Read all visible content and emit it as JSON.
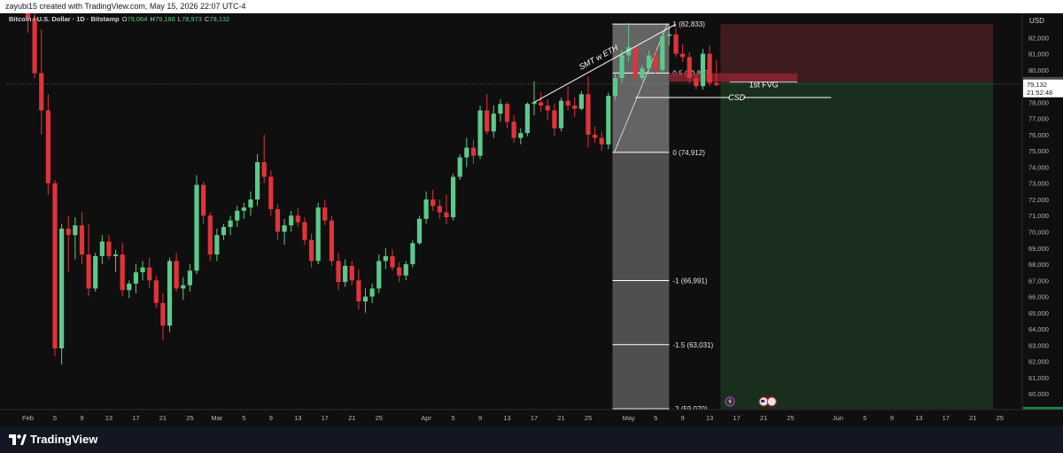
{
  "header": {
    "credit": "zayubi15 created with TradingView.com, May 15, 2026 22:07 UTC-4"
  },
  "legend": {
    "symbol": "Bitcoin / U.S. Dollar · 1D · Bitstamp",
    "o_label": "O",
    "o_value": "79,064",
    "h_label": "H",
    "h_value": "79,186",
    "l_label": "L",
    "l_value": "78,973",
    "c_label": "C",
    "c_value": "79,132"
  },
  "price_scale": {
    "currency": "USD",
    "last_price": "79,132",
    "countdown": "21:52:48",
    "ref_price": "79,264",
    "bottom_price": "59,020"
  },
  "annotations": {
    "smt": "SMT w ETH",
    "fvg": "1st FVG",
    "csd": "CSD",
    "fib_levels": [
      {
        "ratio": 1,
        "label": "1 (82,833)",
        "price": 82833
      },
      {
        "ratio": 0.5,
        "label": "0.5 (79,807)",
        "price": 79807
      },
      {
        "ratio": 0,
        "label": "0 (74,912)",
        "price": 74912
      },
      {
        "ratio": -1,
        "label": "-1 (66,991)",
        "price": 66991
      },
      {
        "ratio": -1.5,
        "label": "-1.5 (63,031)",
        "price": 63031
      },
      {
        "ratio": -2,
        "label": "-2 (59,070)",
        "price": 59070
      }
    ]
  },
  "colors": {
    "up": "#5cc98a",
    "down": "#e0333a",
    "background": "#0f0f0f",
    "fib_fill": "#5a5a5a",
    "stop_zone": "#3d1b1f",
    "target_zone": "#1a2e1d",
    "fvg_box": "#8a2430",
    "last_price_tag": "#ffffff",
    "bottom_tag": "#1f8a4c"
  },
  "footer": {
    "brand": "TradingView"
  },
  "chart_data": {
    "type": "candlestick",
    "interval": "1D",
    "symbol": "BTCUSD",
    "ylim": [
      59020,
      83500
    ],
    "y_ticks": [
      60000,
      61000,
      62000,
      63000,
      64000,
      65000,
      66000,
      67000,
      68000,
      69000,
      70000,
      71000,
      72000,
      73000,
      74000,
      75000,
      76000,
      77000,
      78000,
      79000,
      80000,
      81000,
      82000
    ],
    "x_ticks": [
      {
        "label": "Feb",
        "i": 0
      },
      {
        "label": "5",
        "i": 4
      },
      {
        "label": "9",
        "i": 8
      },
      {
        "label": "13",
        "i": 12
      },
      {
        "label": "17",
        "i": 16
      },
      {
        "label": "21",
        "i": 20
      },
      {
        "label": "25",
        "i": 24
      },
      {
        "label": "Mar",
        "i": 28
      },
      {
        "label": "5",
        "i": 32
      },
      {
        "label": "9",
        "i": 36
      },
      {
        "label": "13",
        "i": 40
      },
      {
        "label": "17",
        "i": 44
      },
      {
        "label": "21",
        "i": 48
      },
      {
        "label": "25",
        "i": 52
      },
      {
        "label": "Apr",
        "i": 59
      },
      {
        "label": "5",
        "i": 63
      },
      {
        "label": "9",
        "i": 67
      },
      {
        "label": "13",
        "i": 71
      },
      {
        "label": "17",
        "i": 75
      },
      {
        "label": "21",
        "i": 79
      },
      {
        "label": "25",
        "i": 83
      },
      {
        "label": "May",
        "i": 89
      },
      {
        "label": "5",
        "i": 93
      },
      {
        "label": "9",
        "i": 97
      },
      {
        "label": "13",
        "i": 101
      },
      {
        "label": "17",
        "i": 105
      },
      {
        "label": "21",
        "i": 109
      },
      {
        "label": "25",
        "i": 113
      },
      {
        "label": "Jun",
        "i": 120
      },
      {
        "label": "5",
        "i": 124
      },
      {
        "label": "9",
        "i": 128
      },
      {
        "label": "13",
        "i": 132
      },
      {
        "label": "17",
        "i": 136
      },
      {
        "label": "21",
        "i": 140
      },
      {
        "label": "25",
        "i": 144
      }
    ],
    "candles": [
      [
        84800,
        86500,
        82300,
        83200
      ],
      [
        83200,
        85000,
        79500,
        79800
      ],
      [
        79800,
        82500,
        76000,
        77500
      ],
      [
        77500,
        78500,
        72300,
        73000
      ],
      [
        73000,
        73200,
        62300,
        62800
      ],
      [
        62800,
        70500,
        61800,
        70200
      ],
      [
        70200,
        71000,
        67500,
        69800
      ],
      [
        69800,
        70900,
        68300,
        70400
      ],
      [
        70400,
        71200,
        68000,
        68600
      ],
      [
        68600,
        70500,
        66000,
        66500
      ],
      [
        66500,
        68700,
        66300,
        68500
      ],
      [
        68500,
        69800,
        68000,
        69400
      ],
      [
        69400,
        69800,
        68300,
        68500
      ],
      [
        68500,
        68900,
        67500,
        68600
      ],
      [
        68600,
        69300,
        66000,
        66400
      ],
      [
        66400,
        67000,
        65900,
        66800
      ],
      [
        66800,
        68000,
        66200,
        67500
      ],
      [
        67500,
        68200,
        67000,
        67800
      ],
      [
        67800,
        68400,
        66500,
        67000
      ],
      [
        67000,
        67300,
        65300,
        65600
      ],
      [
        65600,
        66200,
        63300,
        64200
      ],
      [
        64200,
        68400,
        63800,
        68200
      ],
      [
        68200,
        68700,
        66300,
        66500
      ],
      [
        66500,
        67200,
        65800,
        66700
      ],
      [
        66700,
        68000,
        66300,
        67600
      ],
      [
        67600,
        73500,
        67400,
        72900
      ],
      [
        72900,
        73100,
        70500,
        71000
      ],
      [
        71000,
        71200,
        68200,
        68600
      ],
      [
        68600,
        70200,
        68200,
        69800
      ],
      [
        69800,
        70500,
        69500,
        70300
      ],
      [
        70300,
        71000,
        69800,
        70700
      ],
      [
        70700,
        71600,
        70300,
        71300
      ],
      [
        71300,
        71800,
        70800,
        71500
      ],
      [
        71500,
        72500,
        71000,
        72000
      ],
      [
        72000,
        74800,
        71600,
        74300
      ],
      [
        74300,
        76000,
        73000,
        73400
      ],
      [
        73400,
        73800,
        71000,
        71400
      ],
      [
        71400,
        71700,
        69500,
        70000
      ],
      [
        70000,
        70800,
        69200,
        70400
      ],
      [
        70400,
        71300,
        70000,
        71000
      ],
      [
        71000,
        71500,
        70300,
        70600
      ],
      [
        70600,
        70900,
        69200,
        69500
      ],
      [
        69500,
        69900,
        67800,
        68200
      ],
      [
        68200,
        71800,
        68000,
        71500
      ],
      [
        71500,
        72000,
        70400,
        70700
      ],
      [
        70700,
        71000,
        67900,
        68200
      ],
      [
        68200,
        68700,
        66400,
        66900
      ],
      [
        66900,
        68300,
        66600,
        67900
      ],
      [
        67900,
        68200,
        66700,
        67000
      ],
      [
        67000,
        67700,
        65200,
        65700
      ],
      [
        65700,
        66500,
        65000,
        66000
      ],
      [
        66000,
        66800,
        65600,
        66500
      ],
      [
        66500,
        68600,
        66200,
        68200
      ],
      [
        68200,
        69000,
        67700,
        68500
      ],
      [
        68500,
        68900,
        67600,
        67800
      ],
      [
        67800,
        68100,
        66900,
        67300
      ],
      [
        67300,
        68200,
        67000,
        68000
      ],
      [
        68000,
        69500,
        67800,
        69300
      ],
      [
        69300,
        71000,
        69200,
        70800
      ],
      [
        70800,
        72500,
        70500,
        72000
      ],
      [
        72000,
        72600,
        71300,
        71600
      ],
      [
        71600,
        72000,
        70800,
        71200
      ],
      [
        71200,
        72300,
        70500,
        70900
      ],
      [
        70900,
        73600,
        70700,
        73400
      ],
      [
        73400,
        74800,
        73200,
        74600
      ],
      [
        74600,
        75800,
        74000,
        75200
      ],
      [
        75200,
        75700,
        74200,
        74700
      ],
      [
        74700,
        77800,
        74500,
        77500
      ],
      [
        77500,
        78500,
        76000,
        76200
      ],
      [
        76200,
        77800,
        75800,
        77300
      ],
      [
        77300,
        78200,
        76800,
        77900
      ],
      [
        77900,
        78000,
        76400,
        76800
      ],
      [
        76800,
        77200,
        75500,
        75800
      ],
      [
        75800,
        76400,
        75400,
        76100
      ],
      [
        76100,
        78000,
        75900,
        77900
      ],
      [
        77900,
        79300,
        77200,
        78000
      ],
      [
        78000,
        78600,
        77400,
        77800
      ],
      [
        77800,
        78200,
        76900,
        77500
      ],
      [
        77500,
        77900,
        75900,
        76400
      ],
      [
        76400,
        78300,
        76200,
        78100
      ],
      [
        78100,
        79000,
        77500,
        77800
      ],
      [
        77800,
        78300,
        77100,
        77600
      ],
      [
        77600,
        78700,
        77500,
        78500
      ],
      [
        78500,
        79600,
        75200,
        76000
      ],
      [
        76000,
        76500,
        75500,
        75800
      ],
      [
        75800,
        76200,
        75000,
        75400
      ],
      [
        75400,
        78600,
        75100,
        78400
      ],
      [
        78400,
        79800,
        78100,
        79500
      ],
      [
        79500,
        81200,
        79200,
        80900
      ],
      [
        80900,
        82900,
        80500,
        81400
      ],
      [
        81400,
        81700,
        79000,
        79500
      ],
      [
        79500,
        80300,
        79300,
        80100
      ],
      [
        80100,
        81200,
        79700,
        80900
      ],
      [
        80900,
        81500,
        79700,
        80000
      ],
      [
        80000,
        82300,
        79800,
        82100
      ],
      [
        82100,
        82800,
        81500,
        82200
      ],
      [
        82200,
        82600,
        80800,
        81000
      ],
      [
        81000,
        81600,
        80500,
        80800
      ],
      [
        80800,
        81100,
        79200,
        79500
      ],
      [
        79500,
        79800,
        78800,
        79000
      ],
      [
        79000,
        81300,
        78800,
        81000
      ],
      [
        81000,
        81500,
        79000,
        79200
      ],
      [
        79200,
        80600,
        79000,
        79064
      ]
    ]
  }
}
